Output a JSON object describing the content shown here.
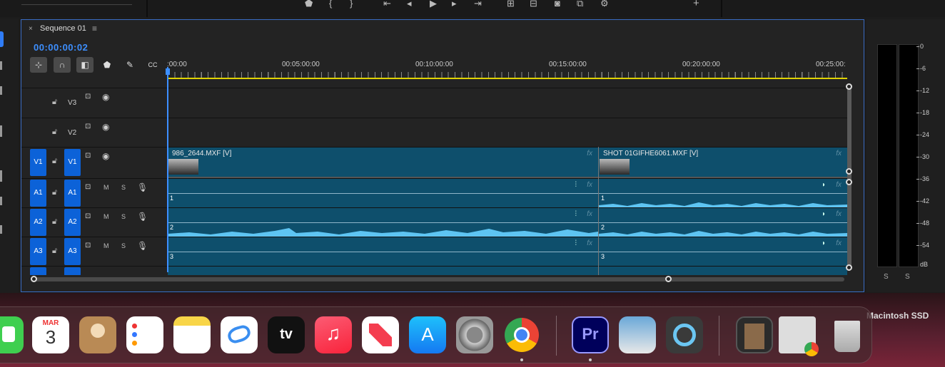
{
  "sequence_panel": {
    "close": "×",
    "title": "Sequence 01",
    "menu": "≡",
    "timecode": "00:00:00:02"
  },
  "ruler": {
    "labels": [
      ":00:00",
      "00:05:00:00",
      "00:10:00:00",
      "00:15:00:00",
      "00:20:00:00",
      "00:25:00:"
    ]
  },
  "video_tracks": [
    {
      "name": "V3"
    },
    {
      "name": "V2"
    },
    {
      "name": "V1",
      "source_target": "V1"
    }
  ],
  "audio_tracks": [
    {
      "name": "A1",
      "source_target": "A1",
      "mute": "M",
      "solo": "S"
    },
    {
      "name": "A2",
      "source_target": "A2",
      "mute": "M",
      "solo": "S"
    },
    {
      "name": "A3",
      "source_target": "A3",
      "mute": "M",
      "solo": "S"
    }
  ],
  "clips": {
    "video1": {
      "label": "986_2644.MXF [V]",
      "fx": "fx"
    },
    "video2": {
      "label": "SHOT 01GIFHE6061.MXF [V]",
      "fx": "fx"
    },
    "fx": "fx",
    "channels": [
      "1",
      "2",
      "3"
    ]
  },
  "meter": {
    "db_labels": [
      "0",
      "-6",
      "-12",
      "-18",
      "-24",
      "-30",
      "-36",
      "-42",
      "-48",
      "-54",
      "dB"
    ],
    "solo_left": "S",
    "solo_right": "S"
  },
  "dock": {
    "calendar_month": "MAR",
    "calendar_day": "3",
    "appletv_label": "tv",
    "premiere_label": "Pr",
    "volume_label": "Macintosh SSD"
  },
  "colors": {
    "accent": "#3d8fff",
    "clip": "#0e4f6c",
    "waveform": "#5ec4f2",
    "track_target": "#0c62d8",
    "work_area": "#e0d200"
  }
}
